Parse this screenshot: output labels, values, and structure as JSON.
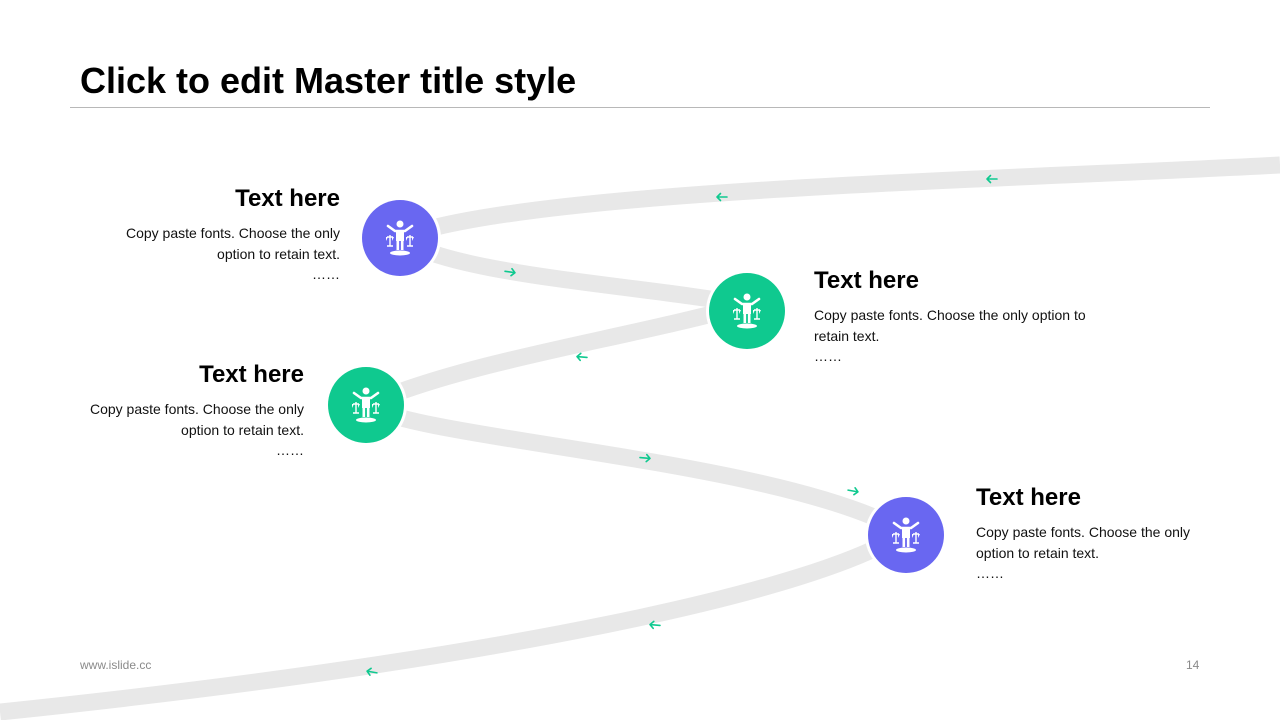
{
  "slide": {
    "title": "Click to edit Master title style",
    "footer_site": "www.islide.cc",
    "page_number": "14"
  },
  "colors": {
    "purple": "#6967f1",
    "green": "#0fc98f",
    "path": "#e8e8e8",
    "arrow": "#0fc98f"
  },
  "steps": [
    {
      "heading": "Text here",
      "body": "Copy paste fonts. Choose the only option to retain text.",
      "ellipsis": "……",
      "icon": "justice-scales-person-icon",
      "color": "purple"
    },
    {
      "heading": "Text here",
      "body": "Copy paste fonts. Choose the only option to retain text.",
      "ellipsis": "……",
      "icon": "justice-scales-person-icon",
      "color": "green"
    },
    {
      "heading": "Text here",
      "body": "Copy paste fonts. Choose the only option to retain text.",
      "ellipsis": "……",
      "icon": "justice-scales-person-icon",
      "color": "green"
    },
    {
      "heading": "Text here",
      "body": "Copy paste fonts. Choose the only option to retain text.",
      "ellipsis": "……",
      "icon": "justice-scales-person-icon",
      "color": "purple"
    }
  ]
}
